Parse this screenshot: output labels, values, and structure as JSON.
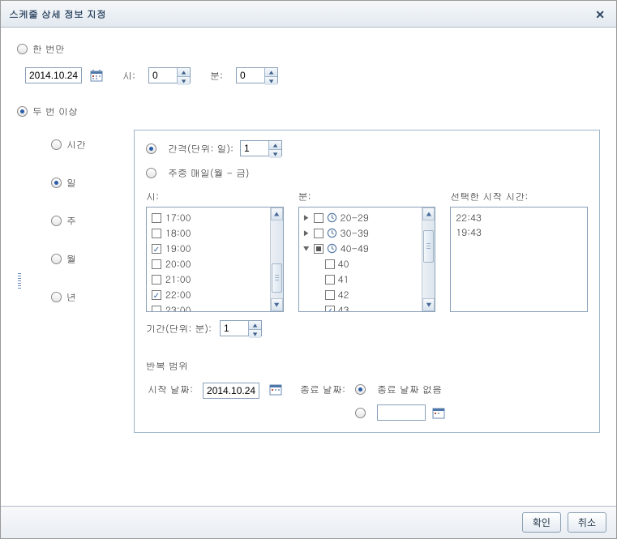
{
  "dialog": {
    "title": "스케줄 상세 정보 지정",
    "close_aria": "닫기"
  },
  "once": {
    "label": "한 번만",
    "date": "2014.10.24",
    "hour_label": "시:",
    "hour_value": "0",
    "minute_label": "분:",
    "minute_value": "0"
  },
  "recurring": {
    "label": "두 번 이상",
    "units": {
      "hour": "시간",
      "day": "일",
      "week": "주",
      "month": "월",
      "year": "년"
    }
  },
  "day_panel": {
    "interval_label": "간격(단위: 일):",
    "interval_value": "1",
    "weekday_label": "주중 매일(월 - 금)",
    "hours_label": "시:",
    "minutes_label": "분:",
    "selected_label": "선택한 시작 시간:",
    "hours": [
      {
        "label": "17:00",
        "checked": false
      },
      {
        "label": "18:00",
        "checked": false
      },
      {
        "label": "19:00",
        "checked": true
      },
      {
        "label": "20:00",
        "checked": false
      },
      {
        "label": "21:00",
        "checked": false
      },
      {
        "label": "22:00",
        "checked": true
      },
      {
        "label": "23:00",
        "checked": false
      }
    ],
    "minute_groups": [
      {
        "label": "20-29",
        "state": "unchecked",
        "expanded": false
      },
      {
        "label": "30-39",
        "state": "unchecked",
        "expanded": false
      },
      {
        "label": "40-49",
        "state": "partial",
        "expanded": true,
        "children": [
          {
            "label": "40",
            "checked": false
          },
          {
            "label": "41",
            "checked": false
          },
          {
            "label": "42",
            "checked": false
          },
          {
            "label": "43",
            "checked": true
          }
        ]
      }
    ],
    "selected_times": [
      "22:43",
      "19:43"
    ],
    "duration_label": "기간(단위: 분):",
    "duration_value": "1"
  },
  "range": {
    "title": "반복 범위",
    "start_label": "시작 날짜:",
    "start_value": "2014.10.24",
    "end_label": "종료 날짜:",
    "no_end_label": "종료 날짜 없음",
    "end_date_value": ""
  },
  "footer": {
    "ok": "확인",
    "cancel": "취소"
  }
}
